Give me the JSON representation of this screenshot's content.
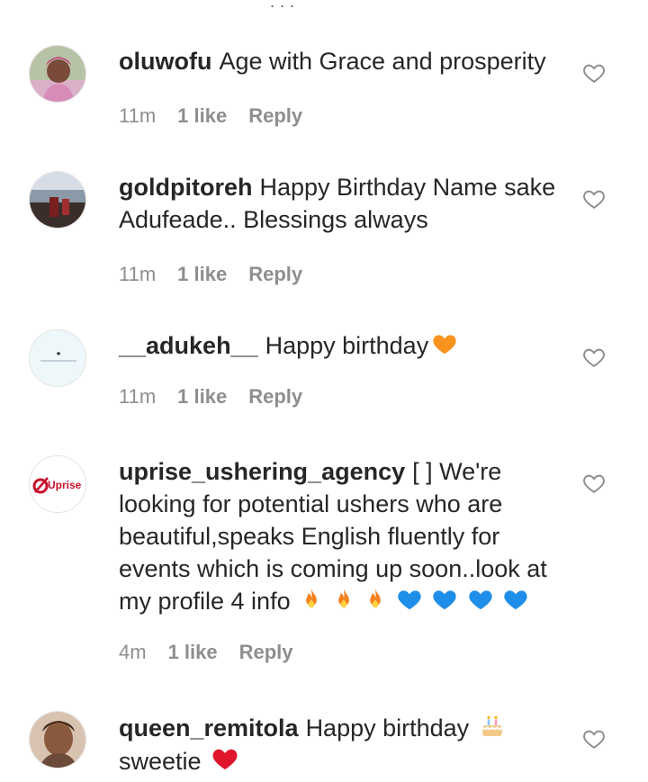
{
  "top_indicator": "...",
  "comments": [
    {
      "username": "oluwofu",
      "text": "Age with Grace and prosperity",
      "time": "11m",
      "likes": "1 like",
      "reply": "Reply"
    },
    {
      "username": "goldpitoreh",
      "text": "Happy Birthday Name sake Adufeade.. Blessings always",
      "time": "11m",
      "likes": "1 like",
      "reply": "Reply"
    },
    {
      "username": "__adukeh__",
      "text": "Happy birthday",
      "time": "11m",
      "likes": "1 like",
      "reply": "Reply"
    },
    {
      "username": "uprise_ushering_agency",
      "text": "[ ] We're looking for potential ushers who are beautiful,speaks English fluently for events which is coming up soon..look at my profile 4 info",
      "time": "4m",
      "likes": "1 like",
      "reply": "Reply"
    },
    {
      "username": "queen_remitola",
      "text": "Happy birthday",
      "text2": "sweetie",
      "time": "",
      "likes": "",
      "reply": ""
    }
  ],
  "emojis": {
    "orange_heart": "orange-heart",
    "fire": "fire",
    "blue_heart": "blue-heart",
    "cake": "birthday-cake",
    "red_heart": "red-heart"
  },
  "avatar_labels": {
    "uprise_logo": "Uprise"
  }
}
